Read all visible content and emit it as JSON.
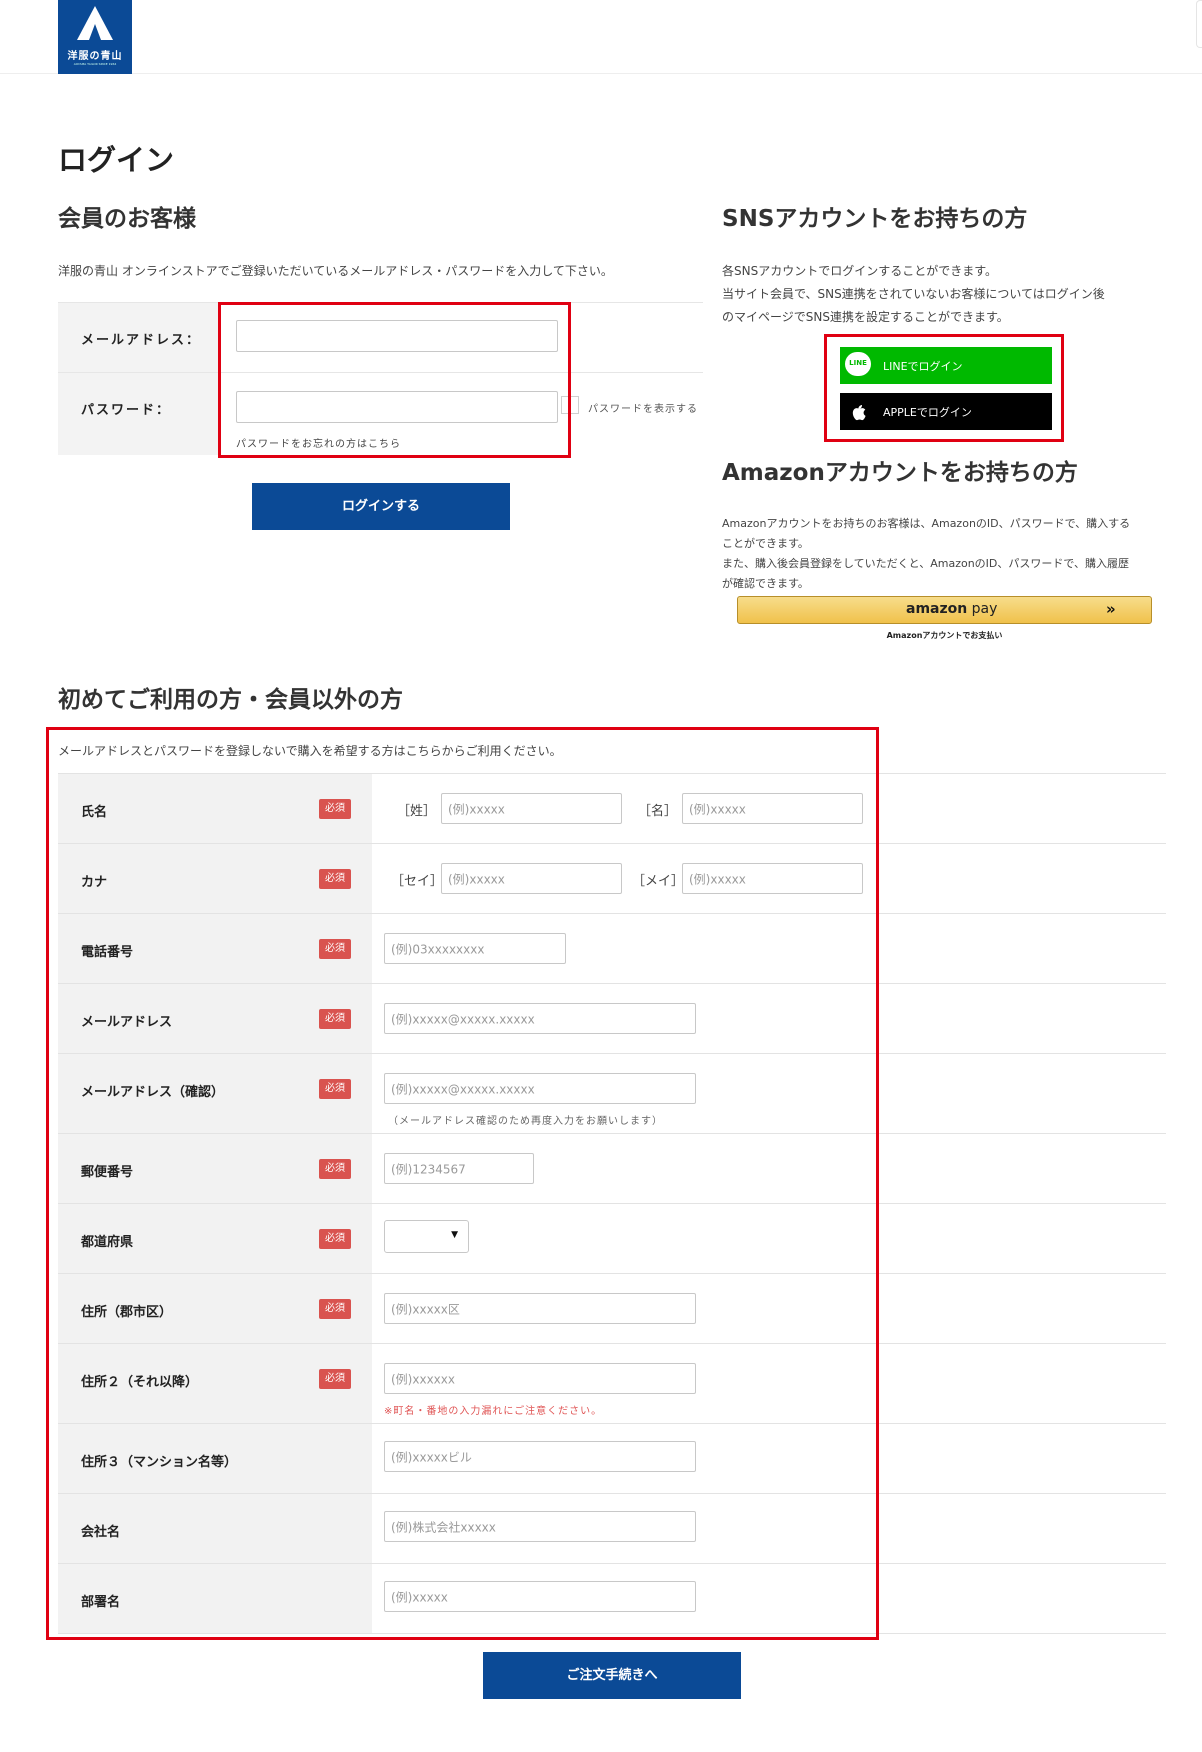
{
  "header": {
    "logo_brand": "洋服の青山",
    "logo_sub": "AOYAMA TAILOR SINCE 1964"
  },
  "page_title": "ログイン",
  "member": {
    "heading": "会員のお客様",
    "description": "洋服の青山 オンラインストアでご登録いただいているメールアドレス・パスワードを入力して下さい。",
    "email_label": "メールアドレス：",
    "password_label": "パスワード：",
    "show_password": "パスワードを表示する",
    "forgot": "パスワードをお忘れの方はこちら",
    "login_button": "ログインする"
  },
  "sns": {
    "heading": "SNSアカウントをお持ちの方",
    "desc1": "各SNSアカウントでログインすることができます。",
    "desc2": "当サイト会員で、SNS連携をされていないお客様についてはログイン後",
    "desc3": "のマイページでSNS連携を設定することができます。",
    "line_badge": "LINE",
    "line_button": "LINEでログイン",
    "apple_button": "APPLEでログイン"
  },
  "amazon": {
    "heading": "Amazonアカウントをお持ちの方",
    "desc1": "Amazonアカウントをお持ちのお客様は、AmazonのID、パスワードで、購入する",
    "desc2": "ことができます。",
    "desc3": "また、購入後会員登録をしていただくと、AmazonのID、パスワードで、購入履歴",
    "desc4": "が確認できます。",
    "logo_amazon": "amazon",
    "logo_pay": "pay",
    "chevron": "»",
    "sub": "Amazonアカウントでお支払い"
  },
  "guest": {
    "heading": "初めてご利用の方・会員以外の方",
    "description": "メールアドレスとパスワードを登録しないで購入を希望する方はこちらからご利用ください。",
    "required": "必須",
    "rows": {
      "name": {
        "label": "氏名",
        "sei": "［姓］",
        "mei": "［名］",
        "ph1": "(例)xxxxx",
        "ph2": "(例)xxxxx"
      },
      "kana": {
        "label": "カナ",
        "sei": "［セイ］",
        "mei": "［メイ］",
        "ph1": "(例)xxxxx",
        "ph2": "(例)xxxxx"
      },
      "phone": {
        "label": "電話番号",
        "ph": "(例)03xxxxxxxx"
      },
      "email": {
        "label": "メールアドレス",
        "ph": "(例)xxxxx@xxxxx.xxxxx"
      },
      "email_confirm": {
        "label": "メールアドレス（確認）",
        "ph": "(例)xxxxx@xxxxx.xxxxx",
        "hint": "（メールアドレス確認のため再度入力をお願いします）"
      },
      "zip": {
        "label": "郵便番号",
        "ph": "(例)1234567"
      },
      "pref": {
        "label": "都道府県",
        "value": "",
        "arrow": "▼"
      },
      "city": {
        "label": "住所（郡市区）",
        "ph": "(例)xxxxx区"
      },
      "addr2": {
        "label": "住所２（それ以降）",
        "ph": "(例)xxxxxx",
        "hint": "※町名・番地の入力漏れにご注意ください。"
      },
      "addr3": {
        "label": "住所３（マンション名等）",
        "ph": "(例)xxxxxビル"
      },
      "company": {
        "label": "会社名",
        "ph": "(例)株式会社xxxxx"
      },
      "dept": {
        "label": "部署名",
        "ph": "(例)xxxxx"
      }
    },
    "submit": "ご注文手続きへ"
  },
  "colors": {
    "brand_blue": "#0b4a96",
    "highlight_red": "#e00012",
    "line_green": "#00b900",
    "required_red": "#d9534f"
  }
}
